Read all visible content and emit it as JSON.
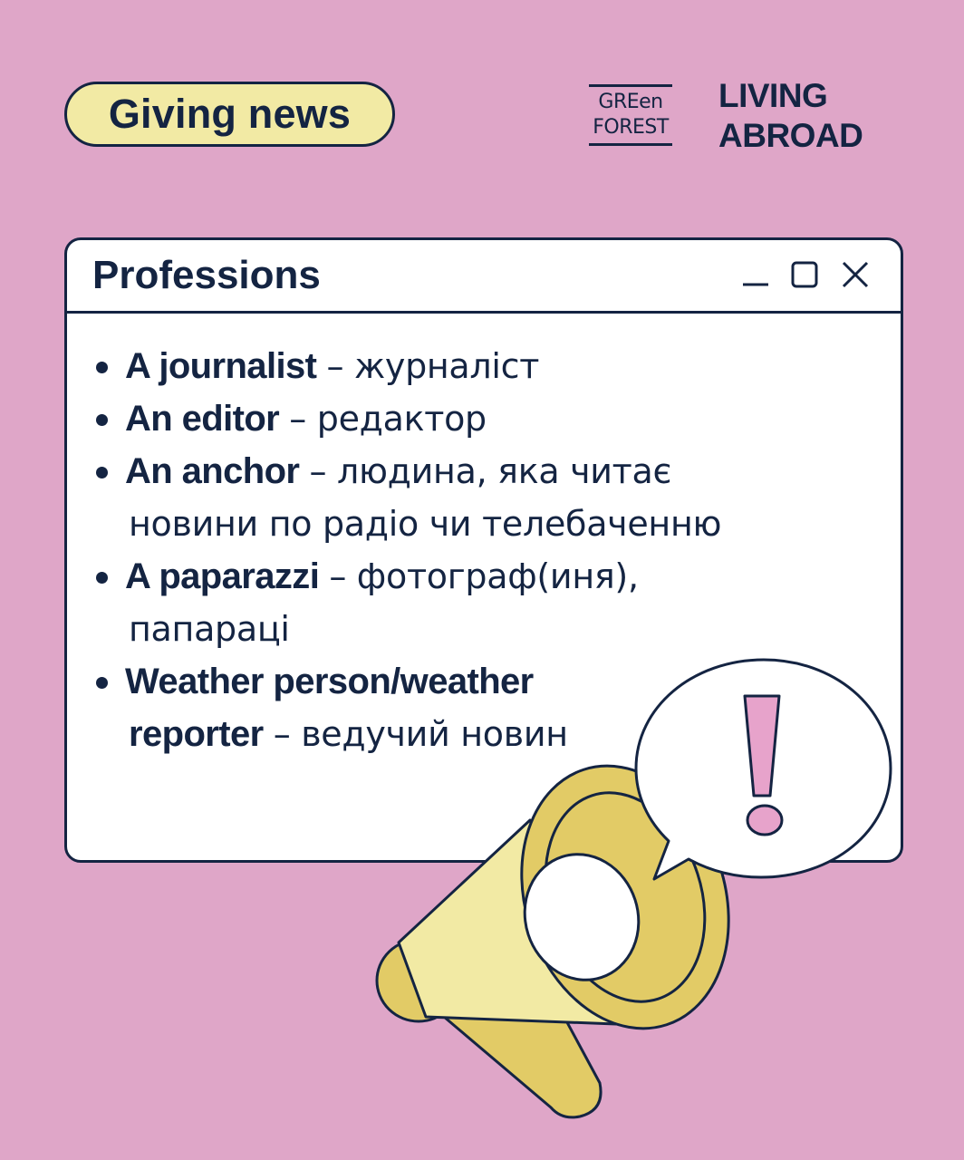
{
  "header": {
    "tag": "Giving news",
    "logo_green_forest_line1": "GREen",
    "logo_green_forest_line2": "FOREST",
    "logo_living": "LIVING",
    "logo_abroad": "ABROAD"
  },
  "window": {
    "title": "Professions",
    "items": [
      {
        "term": "A journalist",
        "def": "– журналіст",
        "cont": ""
      },
      {
        "term": "An editor",
        "def": "– редактор",
        "cont": ""
      },
      {
        "term": "An anchor",
        "def": "– людина, яка читає",
        "cont": "новини по радіо чи телебаченню"
      },
      {
        "term": "A paparazzi",
        "def": "– фотограф(иня),",
        "cont": "папараці"
      },
      {
        "term": "Weather person/weather",
        "def": "",
        "cont_term": "reporter",
        "cont": "– ведучий новин"
      }
    ]
  },
  "colors": {
    "background": "#dfa6c8",
    "ink": "#142442",
    "pill": "#f2eaa4",
    "megaphone": "#e2cb66",
    "accent": "#e7a3cb"
  },
  "icons": [
    "minimize-icon",
    "maximize-icon",
    "close-icon",
    "megaphone-icon",
    "exclamation-icon"
  ]
}
